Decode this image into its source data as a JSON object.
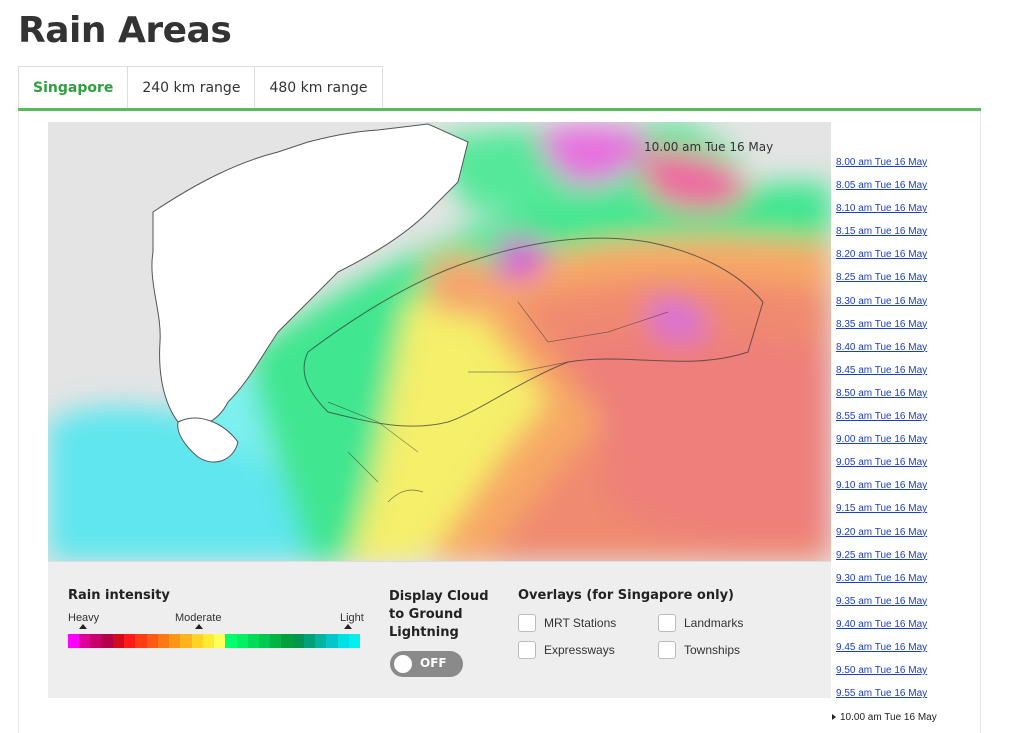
{
  "page": {
    "title": "Rain Areas"
  },
  "tabs": [
    {
      "label": "Singapore",
      "active": true
    },
    {
      "label": "240 km range",
      "active": false
    },
    {
      "label": "480 km range",
      "active": false
    }
  ],
  "map": {
    "timestamp": "10.00 am Tue 16 May"
  },
  "legend": {
    "title": "Rain intensity",
    "heavy": "Heavy",
    "moderate": "Moderate",
    "light": "Light",
    "colors": [
      "#ff00ff",
      "#e0009a",
      "#c8006e",
      "#b4004b",
      "#d20a1e",
      "#ff1a1a",
      "#ff3c14",
      "#ff5a14",
      "#ff7814",
      "#ff9614",
      "#ffb41e",
      "#ffd228",
      "#ffeb32",
      "#ffff5a",
      "#00ff6e",
      "#00f064",
      "#00dc5a",
      "#00c850",
      "#00b446",
      "#00a03c",
      "#009650",
      "#00a078",
      "#00b4a0",
      "#00c8c8",
      "#00e1e6",
      "#00f0f0"
    ]
  },
  "lightning": {
    "title": "Display Cloud to Ground Lightning",
    "toggle_label": "OFF"
  },
  "overlays": {
    "title": "Overlays (for Singapore only)",
    "mrt": "MRT Stations",
    "landmarks": "Landmarks",
    "expressways": "Expressways",
    "townships": "Townships"
  },
  "times": [
    "8.00 am Tue 16 May",
    "8.05 am Tue 16 May",
    "8.10 am Tue 16 May",
    "8.15 am Tue 16 May",
    "8.20 am Tue 16 May",
    "8.25 am Tue 16 May",
    "8.30 am Tue 16 May",
    "8.35 am Tue 16 May",
    "8.40 am Tue 16 May",
    "8.45 am Tue 16 May",
    "8.50 am Tue 16 May",
    "8.55 am Tue 16 May",
    "9.00 am Tue 16 May",
    "9.05 am Tue 16 May",
    "9.10 am Tue 16 May",
    "9.15 am Tue 16 May",
    "9.20 am Tue 16 May",
    "9.25 am Tue 16 May",
    "9.30 am Tue 16 May",
    "9.35 am Tue 16 May",
    "9.40 am Tue 16 May",
    "9.45 am Tue 16 May",
    "9.50 am Tue 16 May",
    "9.55 am Tue 16 May"
  ],
  "current_time": "10.00 am Tue 16 May"
}
